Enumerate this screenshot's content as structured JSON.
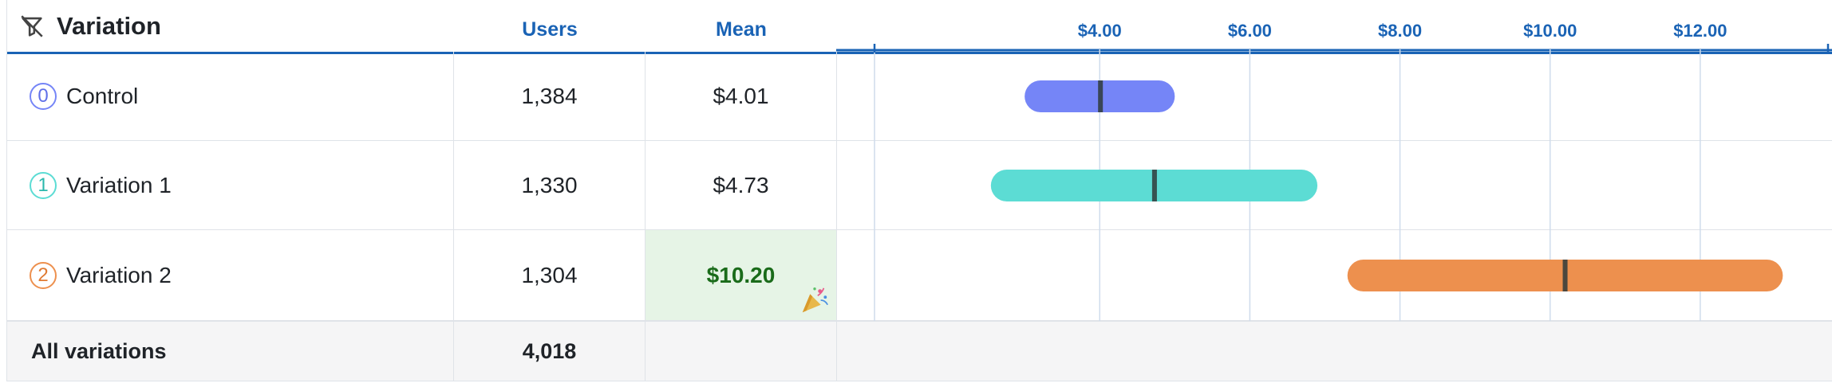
{
  "header": {
    "title": "Variation",
    "filter_icon": "filter-off-icon",
    "users_label": "Users",
    "mean_label": "Mean"
  },
  "rows": [
    {
      "badge": "0",
      "name": "Control",
      "users": "1,384",
      "mean": "$4.01",
      "color": "#7585f7",
      "winner": false
    },
    {
      "badge": "1",
      "name": "Variation 1",
      "users": "1,330",
      "mean": "$4.73",
      "color": "#5cdcd4",
      "winner": false
    },
    {
      "badge": "2",
      "name": "Variation 2",
      "users": "1,304",
      "mean": "$10.20",
      "color": "#ed904e",
      "winner": true,
      "winner_icon": "party-popper-icon"
    }
  ],
  "footer": {
    "label": "All variations",
    "users": "4,018"
  },
  "chart_data": {
    "type": "interval",
    "x_ticks": [
      4,
      6,
      8,
      10,
      12
    ],
    "x_tick_labels": [
      "$4.00",
      "$6.00",
      "$8.00",
      "$10.00",
      "$12.00"
    ],
    "xlim": [
      1.0,
      13.5
    ],
    "series": [
      {
        "low": 3.0,
        "mean": 4.01,
        "high": 5.0,
        "color": "#7585f7"
      },
      {
        "low": 2.55,
        "mean": 4.73,
        "high": 6.9,
        "color": "#5cdcd4"
      },
      {
        "low": 7.3,
        "mean": 10.2,
        "high": 13.1,
        "color": "#ed904e"
      }
    ]
  }
}
